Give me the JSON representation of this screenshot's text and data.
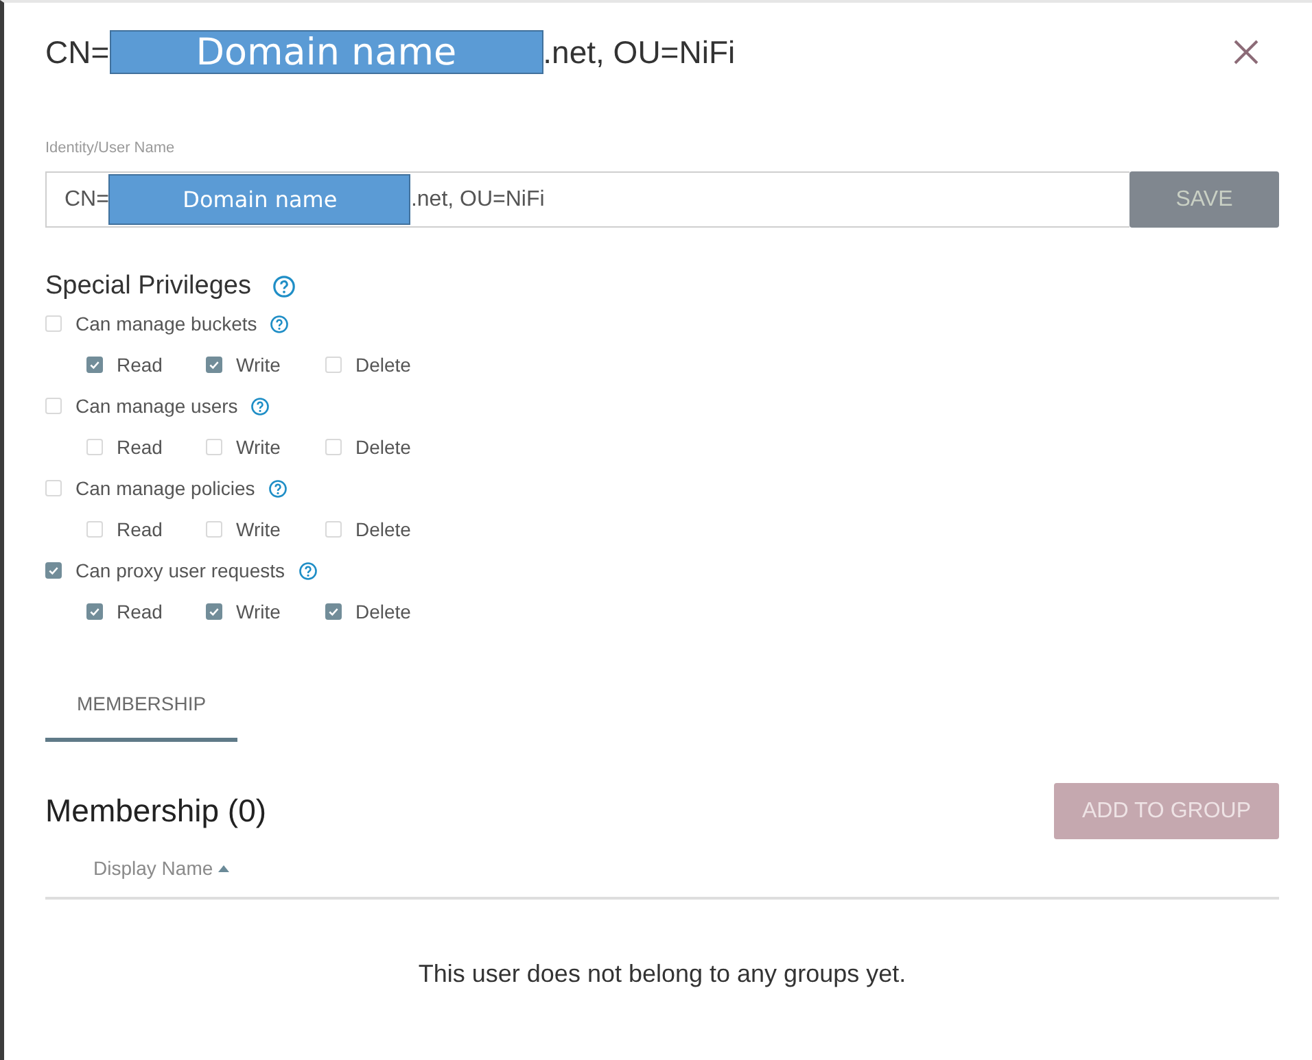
{
  "dialog": {
    "title": [
      {
        "kind": "text",
        "text": "CN="
      },
      {
        "kind": "redaction",
        "text": "Domain name"
      },
      {
        "kind": "text",
        "text": ".net, OU=NiFi"
      }
    ]
  },
  "identity": {
    "label": "Identity/User Name",
    "value": [
      {
        "kind": "text",
        "text": "CN="
      },
      {
        "kind": "redaction",
        "text": "Domain name"
      },
      {
        "kind": "text",
        "text": ".net, OU=NiFi"
      }
    ],
    "save_button": {
      "label": "SAVE",
      "disabled": true
    }
  },
  "special_privileges": {
    "title": "Special Privileges",
    "items": [
      {
        "label": "Can manage buckets",
        "checked": false,
        "permissions": [
          {
            "label": "Read",
            "checked": true
          },
          {
            "label": "Write",
            "checked": true
          },
          {
            "label": "Delete",
            "checked": false
          }
        ]
      },
      {
        "label": "Can manage users",
        "checked": false,
        "permissions": [
          {
            "label": "Read",
            "checked": false
          },
          {
            "label": "Write",
            "checked": false
          },
          {
            "label": "Delete",
            "checked": false
          }
        ]
      },
      {
        "label": "Can manage policies",
        "checked": false,
        "permissions": [
          {
            "label": "Read",
            "checked": false
          },
          {
            "label": "Write",
            "checked": false
          },
          {
            "label": "Delete",
            "checked": false
          }
        ]
      },
      {
        "label": "Can proxy user requests",
        "checked": true,
        "permissions": [
          {
            "label": "Read",
            "checked": true
          },
          {
            "label": "Write",
            "checked": true
          },
          {
            "label": "Delete",
            "checked": true
          }
        ]
      }
    ]
  },
  "tabs": [
    {
      "label": "MEMBERSHIP",
      "selected": true
    }
  ],
  "membership": {
    "title": "Membership (0)",
    "add_button": {
      "label": "ADD TO GROUP",
      "disabled": true
    },
    "columns": [
      {
        "label": "Display Name",
        "sorted": true
      }
    ],
    "empty_message": "This user does not belong to any groups yet."
  }
}
